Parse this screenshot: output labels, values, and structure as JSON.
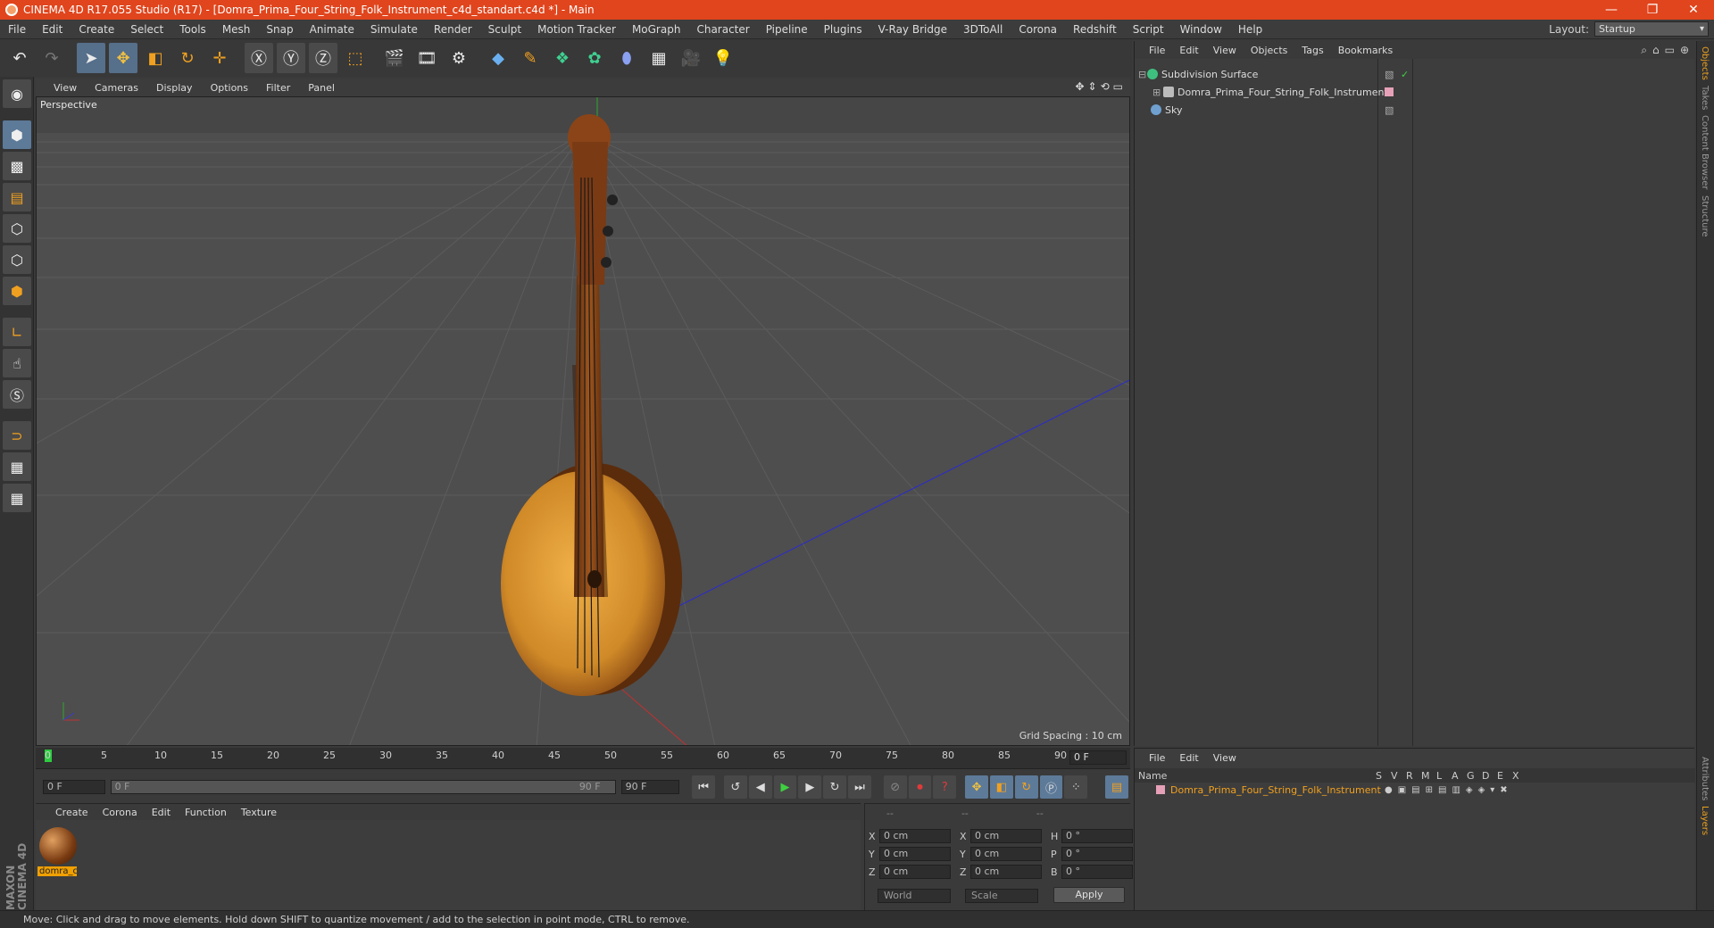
{
  "window": {
    "title": "CINEMA 4D R17.055 Studio (R17) - [Domra_Prima_Four_String_Folk_Instrument_c4d_standart.c4d *] - Main",
    "minimize": "—",
    "restore": "❐",
    "close": "✕"
  },
  "menu": [
    "File",
    "Edit",
    "Create",
    "Select",
    "Tools",
    "Mesh",
    "Snap",
    "Animate",
    "Simulate",
    "Render",
    "Sculpt",
    "Motion Tracker",
    "MoGraph",
    "Character",
    "Pipeline",
    "Plugins",
    "V-Ray Bridge",
    "3DToAll",
    "Corona",
    "Redshift",
    "Script",
    "Window",
    "Help"
  ],
  "layout": {
    "label": "Layout:",
    "value": "Startup"
  },
  "viewport": {
    "menu": [
      "View",
      "Cameras",
      "Display",
      "Options",
      "Filter",
      "Panel"
    ],
    "label": "Perspective",
    "grid_spacing": "Grid Spacing : 10 cm"
  },
  "timeline": {
    "ticks": [
      "0",
      "5",
      "10",
      "15",
      "20",
      "25",
      "30",
      "35",
      "40",
      "45",
      "50",
      "55",
      "60",
      "65",
      "70",
      "75",
      "80",
      "85",
      "90"
    ],
    "current_frame": "0 F",
    "start_field": "0 F",
    "range_start": "0 F",
    "range_end": "90 F",
    "end_field": "90 F"
  },
  "materials": {
    "menu": [
      "Create",
      "Corona",
      "Edit",
      "Function",
      "Texture"
    ],
    "items": [
      {
        "name": "domra_c"
      }
    ]
  },
  "maxon_logo": "MAXON CINEMA 4D",
  "coords": {
    "headers": [
      "--",
      "--",
      "--"
    ],
    "rows": [
      {
        "a": "X",
        "av": "0 cm",
        "b": "X",
        "bv": "0 cm",
        "c": "H",
        "cv": "0 °"
      },
      {
        "a": "Y",
        "av": "0 cm",
        "b": "Y",
        "bv": "0 cm",
        "c": "P",
        "cv": "0 °"
      },
      {
        "a": "Z",
        "av": "0 cm",
        "b": "Z",
        "bv": "0 cm",
        "c": "B",
        "cv": "0 °"
      }
    ],
    "mode": "World",
    "scale": "Scale",
    "apply": "Apply"
  },
  "objects": {
    "menu": [
      "File",
      "Edit",
      "View",
      "Objects",
      "Tags",
      "Bookmarks"
    ],
    "items": [
      {
        "name": "Subdivision Surface",
        "color": "#3fbf7f"
      },
      {
        "name": "Domra_Prima_Four_String_Folk_Instrument",
        "color": "#d0d0d0"
      },
      {
        "name": "Sky",
        "color": "#6fa0d0"
      }
    ]
  },
  "layers": {
    "menu": [
      "File",
      "Edit",
      "View"
    ],
    "header_name": "Name",
    "columns": [
      "S",
      "V",
      "R",
      "M",
      "L",
      "A",
      "G",
      "D",
      "E",
      "X"
    ],
    "row_name": "Domra_Prima_Four_String_Folk_Instrument"
  },
  "side_tabs": [
    "Objects",
    "Takes",
    "Content Browser",
    "Structure"
  ],
  "side_tabs_bottom": [
    "Attributes",
    "Layers"
  ],
  "status": "Move: Click and drag to move elements. Hold down SHIFT to quantize movement / add to the selection in point mode, CTRL to remove."
}
